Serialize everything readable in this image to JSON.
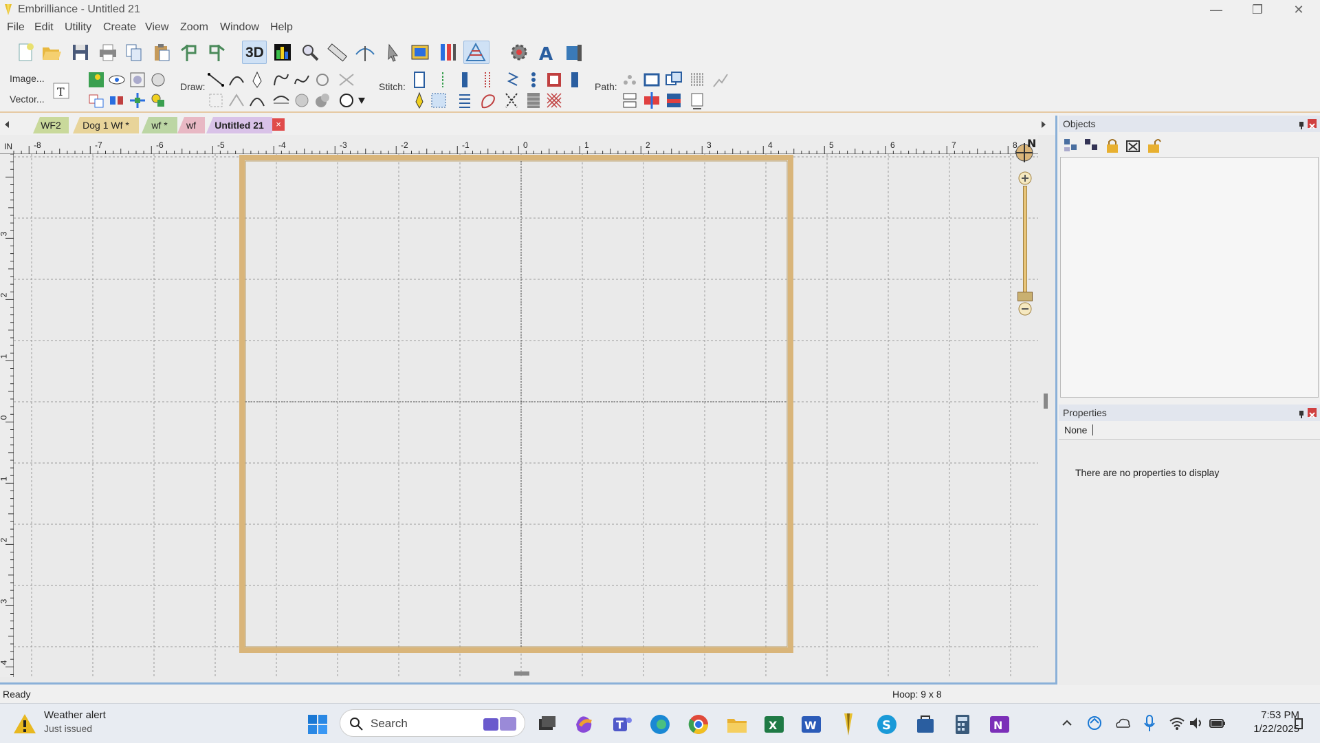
{
  "window": {
    "title": "Embrilliance - Untitled 21",
    "minimize_glyph": "—",
    "maximize_glyph": "❐",
    "close_glyph": "✕"
  },
  "menu": [
    "File",
    "Edit",
    "Utility",
    "Create",
    "View",
    "Zoom",
    "Window",
    "Help"
  ],
  "toolbar": {
    "three_d_label": "3D",
    "image_button": "Image...",
    "vector_button": "Vector...",
    "draw_label": "Draw:",
    "stitch_label": "Stitch:",
    "path_label": "Path:"
  },
  "tabs": [
    {
      "label": "WF2",
      "color": "#c9d99b"
    },
    {
      "label": "Dog 1 Wf *",
      "color": "#e8d49a"
    },
    {
      "label": "wf *",
      "color": "#bcd6a4"
    },
    {
      "label": "wf",
      "color": "#e8b8c4"
    },
    {
      "label": "Untitled 21",
      "color": "#d9c2e8"
    }
  ],
  "tab_close_glyph": "×",
  "ruler": {
    "unit": "IN",
    "top_ticks": [
      "-8",
      "-7",
      "-6",
      "-5",
      "-4",
      "-3",
      "-2",
      "-1",
      "0",
      "1",
      "2",
      "3",
      "4",
      "5",
      "6",
      "7",
      "8"
    ],
    "left_ticks": [
      "3",
      "2",
      "1",
      "0",
      "1",
      "2",
      "3",
      "4"
    ]
  },
  "compass_label": "N",
  "objects_panel": {
    "title": "Objects"
  },
  "properties_panel": {
    "title": "Properties",
    "selected": "None",
    "empty_message": "There are no properties to display"
  },
  "status": {
    "left": "Ready",
    "hoop": "Hoop: 9  x 8"
  },
  "taskbar": {
    "weather_title": "Weather alert",
    "weather_sub": "Just issued",
    "search_label": "Search",
    "time": "7:53 PM",
    "date": "1/22/2025"
  },
  "colors": {
    "hoop": "#d9b57a",
    "accent": "#0078d4"
  }
}
